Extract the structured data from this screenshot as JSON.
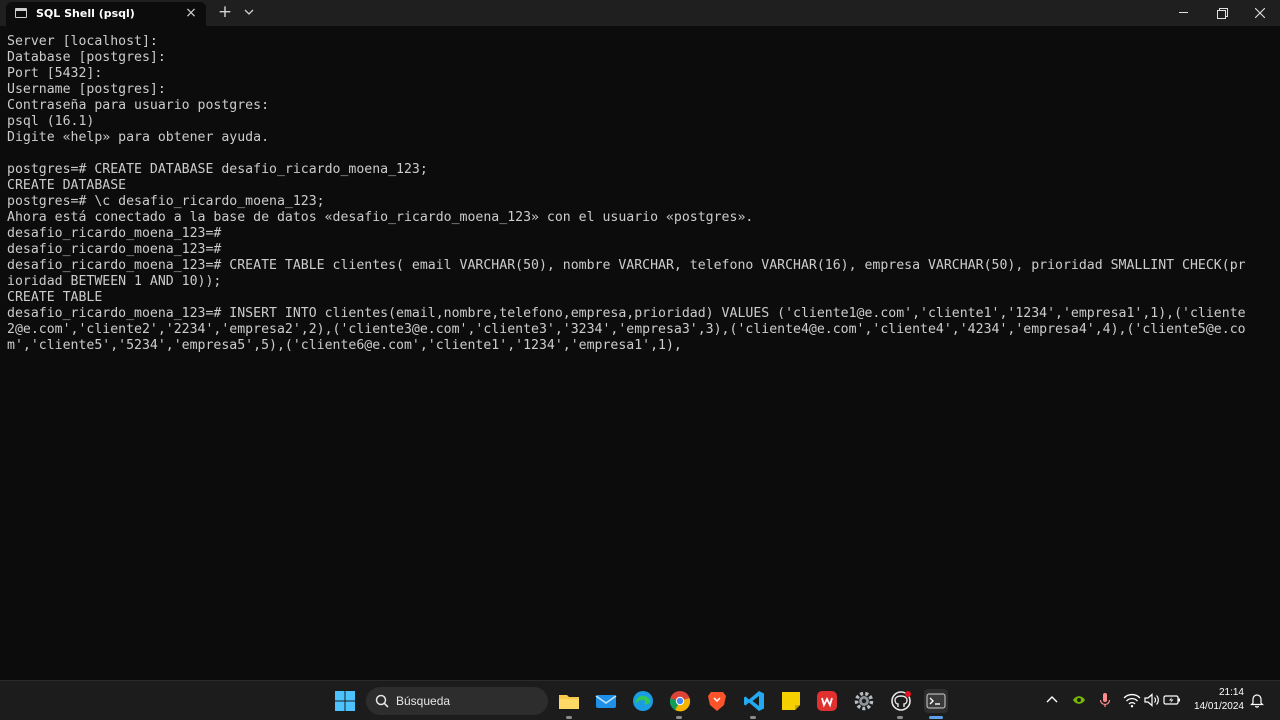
{
  "window": {
    "tab_title": "SQL Shell (psql)",
    "tab_close": "×",
    "new_tab": "+"
  },
  "terminal": {
    "lines": [
      "Server [localhost]:",
      "Database [postgres]:",
      "Port [5432]:",
      "Username [postgres]:",
      "Contraseña para usuario postgres:",
      "psql (16.1)",
      "Digite «help» para obtener ayuda.",
      "",
      "postgres=# CREATE DATABASE desafio_ricardo_moena_123;",
      "CREATE DATABASE",
      "postgres=# \\c desafio_ricardo_moena_123;",
      "Ahora está conectado a la base de datos «desafio_ricardo_moena_123» con el usuario «postgres».",
      "desafio_ricardo_moena_123=#",
      "desafio_ricardo_moena_123=#",
      "desafio_ricardo_moena_123=# CREATE TABLE clientes( email VARCHAR(50), nombre VARCHAR, telefono VARCHAR(16), empresa VARCHAR(50), prioridad SMALLINT CHECK(pr",
      "ioridad BETWEEN 1 AND 10));",
      "CREATE TABLE",
      "desafio_ricardo_moena_123=# INSERT INTO clientes(email,nombre,telefono,empresa,prioridad) VALUES ('cliente1@e.com','cliente1','1234','empresa1',1),('cliente",
      "2@e.com','cliente2','2234','empresa2',2),('cliente3@e.com','cliente3','3234','empresa3',3),('cliente4@e.com','cliente4','4234','empresa4',4),('cliente5@e.co",
      "m','cliente5','5234','empresa5',5),('cliente6@e.com','cliente1','1234','empresa1',1),"
    ]
  },
  "taskbar": {
    "search_placeholder": "Búsqueda",
    "time": "21:14",
    "date": "14/01/2024",
    "icons": [
      "windows-start-icon",
      "search-icon",
      "file-explorer-icon",
      "mail-icon",
      "edge-browser-icon",
      "chrome-browser-icon",
      "brave-browser-icon",
      "vscode-icon",
      "sticky-notes-icon",
      "app-red-icon",
      "settings-icon",
      "github-icon",
      "terminal-icon"
    ],
    "tray_icons": [
      "chevron-up-icon",
      "nvidia-icon",
      "microphone-icon",
      "wifi-icon",
      "volume-icon",
      "battery-icon",
      "notification-bell-icon"
    ]
  }
}
